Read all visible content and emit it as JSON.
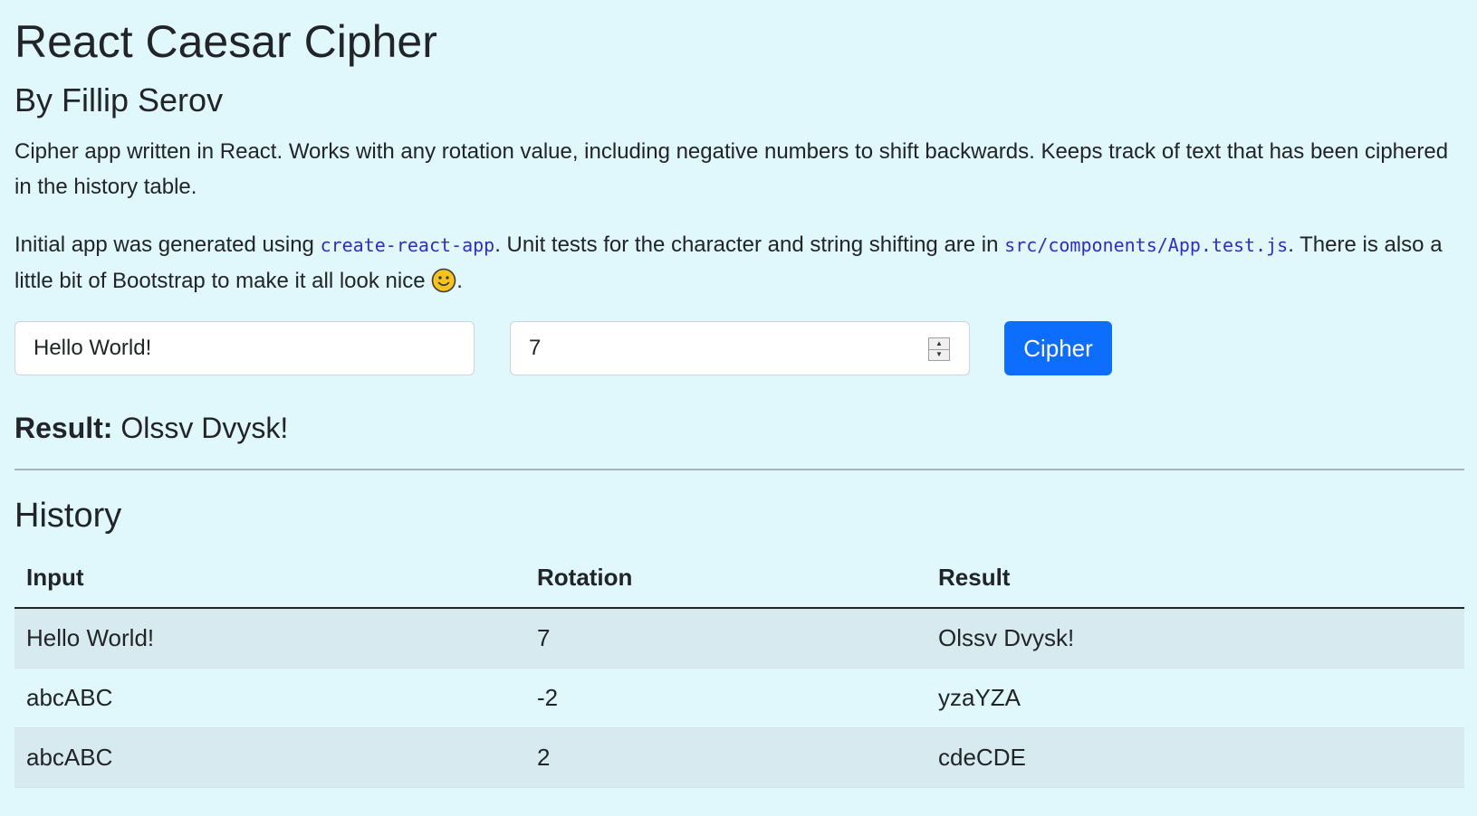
{
  "header": {
    "title": "React Caesar Cipher",
    "byline": "By Fillip Serov"
  },
  "intro": {
    "p1": "Cipher app written in React. Works with any rotation value, including negative numbers to shift backwards. Keeps track of text that has been ciphered in the history table.",
    "p2_part1": "Initial app was generated using ",
    "p2_code1": "create-react-app",
    "p2_part2": ". Unit tests for the character and string shifting are in ",
    "p2_code2": "src/components/App.test.js",
    "p2_part3": ". There is also a little bit of Bootstrap to make it all look nice ",
    "p2_part4": ".",
    "emoji_icon": "smiley-face-icon"
  },
  "form": {
    "text_value": "Hello World!",
    "rotation_value": "7",
    "cipher_label": "Cipher"
  },
  "result": {
    "label": "Result:",
    "value": "Olssv Dvysk!"
  },
  "history": {
    "heading": "History",
    "columns": [
      "Input",
      "Rotation",
      "Result"
    ],
    "rows": [
      {
        "input": "Hello World!",
        "rotation": "7",
        "result": "Olssv Dvysk!"
      },
      {
        "input": "abcABC",
        "rotation": "-2",
        "result": "yzaYZA"
      },
      {
        "input": "abcABC",
        "rotation": "2",
        "result": "cdeCDE"
      }
    ]
  },
  "colors": {
    "background": "#e0f7fc",
    "primary_button": "#0d6efd",
    "code_text": "#2d2fc3",
    "striped_row": "#d6eaf0"
  }
}
